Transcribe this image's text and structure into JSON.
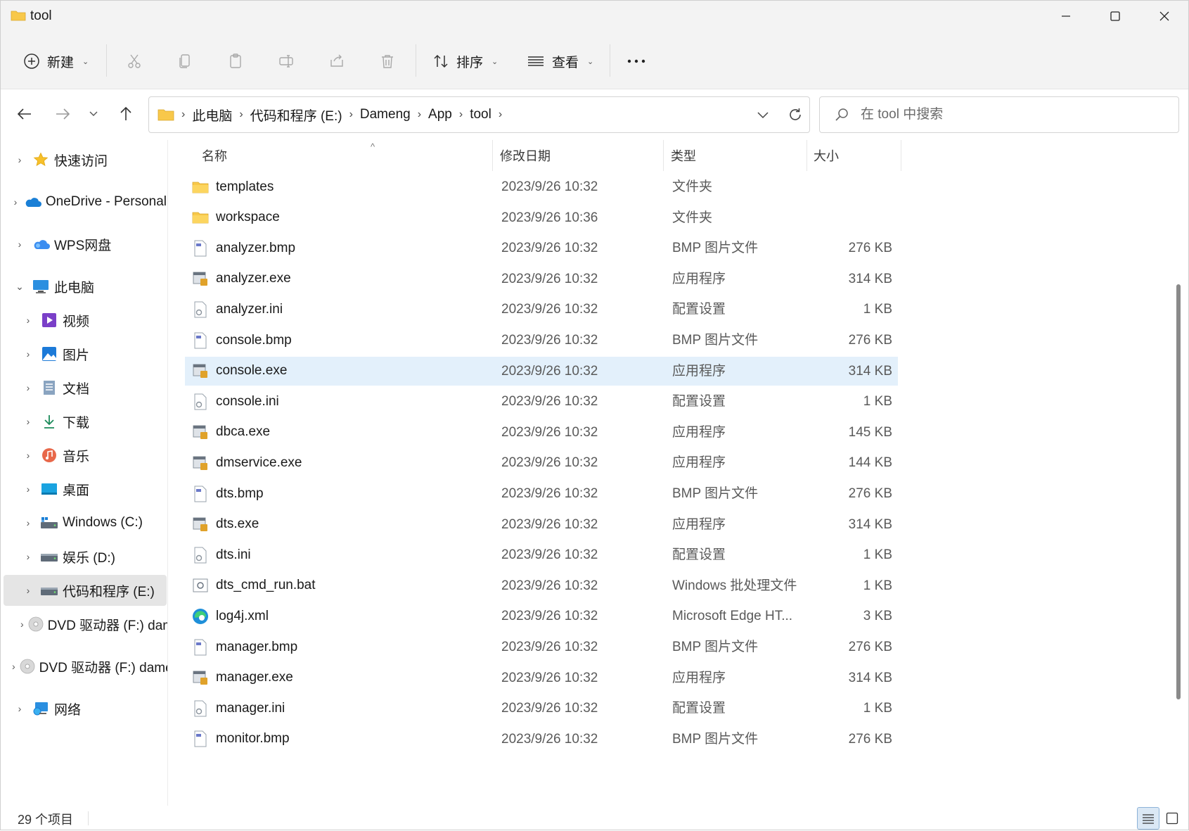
{
  "window": {
    "title": "tool"
  },
  "toolbar": {
    "new_label": "新建",
    "sort_label": "排序",
    "view_label": "查看"
  },
  "address": {
    "crumbs": [
      "此电脑",
      "代码和程序 (E:)",
      "Dameng",
      "App",
      "tool"
    ]
  },
  "search": {
    "placeholder": "在 tool 中搜索"
  },
  "sidebar": {
    "items": [
      {
        "label": "快速访问",
        "icon": "star-icon"
      },
      {
        "label": "OneDrive - Personal",
        "icon": "onedrive-cloud-icon"
      },
      {
        "label": "WPS网盘",
        "icon": "wps-cloud-icon"
      },
      {
        "label": "此电脑",
        "icon": "computer-icon"
      },
      {
        "label": "视频",
        "icon": "videos-icon"
      },
      {
        "label": "图片",
        "icon": "pictures-icon"
      },
      {
        "label": "文档",
        "icon": "documents-icon"
      },
      {
        "label": "下载",
        "icon": "downloads-icon"
      },
      {
        "label": "音乐",
        "icon": "music-icon"
      },
      {
        "label": "桌面",
        "icon": "desktop-icon"
      },
      {
        "label": "Windows (C:)",
        "icon": "windows-drive-icon"
      },
      {
        "label": "娱乐 (D:)",
        "icon": "drive-icon"
      },
      {
        "label": "代码和程序 (E:)",
        "icon": "drive-icon"
      },
      {
        "label": "DVD 驱动器 (F:) dameng",
        "icon": "dvd-icon"
      },
      {
        "label": "DVD 驱动器 (F:) dameng",
        "icon": "dvd-icon"
      },
      {
        "label": "网络",
        "icon": "network-icon"
      }
    ]
  },
  "columns": {
    "name": "名称",
    "date": "修改日期",
    "type": "类型",
    "size": "大小"
  },
  "files": [
    {
      "name": "templates",
      "date": "2023/9/26 10:32",
      "type": "文件夹",
      "size": "",
      "icon": "folder-icon"
    },
    {
      "name": "workspace",
      "date": "2023/9/26 10:36",
      "type": "文件夹",
      "size": "",
      "icon": "folder-icon"
    },
    {
      "name": "analyzer.bmp",
      "date": "2023/9/26 10:32",
      "type": "BMP 图片文件",
      "size": "276 KB",
      "icon": "bmp-file-icon"
    },
    {
      "name": "analyzer.exe",
      "date": "2023/9/26 10:32",
      "type": "应用程序",
      "size": "314 KB",
      "icon": "exe-file-icon"
    },
    {
      "name": "analyzer.ini",
      "date": "2023/9/26 10:32",
      "type": "配置设置",
      "size": "1 KB",
      "icon": "ini-file-icon"
    },
    {
      "name": "console.bmp",
      "date": "2023/9/26 10:32",
      "type": "BMP 图片文件",
      "size": "276 KB",
      "icon": "bmp-file-icon"
    },
    {
      "name": "console.exe",
      "date": "2023/9/26 10:32",
      "type": "应用程序",
      "size": "314 KB",
      "icon": "exe-file-icon"
    },
    {
      "name": "console.ini",
      "date": "2023/9/26 10:32",
      "type": "配置设置",
      "size": "1 KB",
      "icon": "ini-file-icon"
    },
    {
      "name": "dbca.exe",
      "date": "2023/9/26 10:32",
      "type": "应用程序",
      "size": "145 KB",
      "icon": "exe-file-icon"
    },
    {
      "name": "dmservice.exe",
      "date": "2023/9/26 10:32",
      "type": "应用程序",
      "size": "144 KB",
      "icon": "exe-file-icon"
    },
    {
      "name": "dts.bmp",
      "date": "2023/9/26 10:32",
      "type": "BMP 图片文件",
      "size": "276 KB",
      "icon": "bmp-file-icon"
    },
    {
      "name": "dts.exe",
      "date": "2023/9/26 10:32",
      "type": "应用程序",
      "size": "314 KB",
      "icon": "exe-file-icon"
    },
    {
      "name": "dts.ini",
      "date": "2023/9/26 10:32",
      "type": "配置设置",
      "size": "1 KB",
      "icon": "ini-file-icon"
    },
    {
      "name": "dts_cmd_run.bat",
      "date": "2023/9/26 10:32",
      "type": "Windows 批处理文件",
      "size": "1 KB",
      "icon": "bat-file-icon"
    },
    {
      "name": "log4j.xml",
      "date": "2023/9/26 10:32",
      "type": "Microsoft Edge HT...",
      "size": "3 KB",
      "icon": "edge-icon"
    },
    {
      "name": "manager.bmp",
      "date": "2023/9/26 10:32",
      "type": "BMP 图片文件",
      "size": "276 KB",
      "icon": "bmp-file-icon"
    },
    {
      "name": "manager.exe",
      "date": "2023/9/26 10:32",
      "type": "应用程序",
      "size": "314 KB",
      "icon": "exe-file-icon"
    },
    {
      "name": "manager.ini",
      "date": "2023/9/26 10:32",
      "type": "配置设置",
      "size": "1 KB",
      "icon": "ini-file-icon"
    },
    {
      "name": "monitor.bmp",
      "date": "2023/9/26 10:32",
      "type": "BMP 图片文件",
      "size": "276 KB",
      "icon": "bmp-file-icon"
    }
  ],
  "status": {
    "count": "29 个项目"
  },
  "colors": {
    "folder": "#f8c84a",
    "selected_row": "#e3f0fb",
    "accent": "#0067c0"
  }
}
